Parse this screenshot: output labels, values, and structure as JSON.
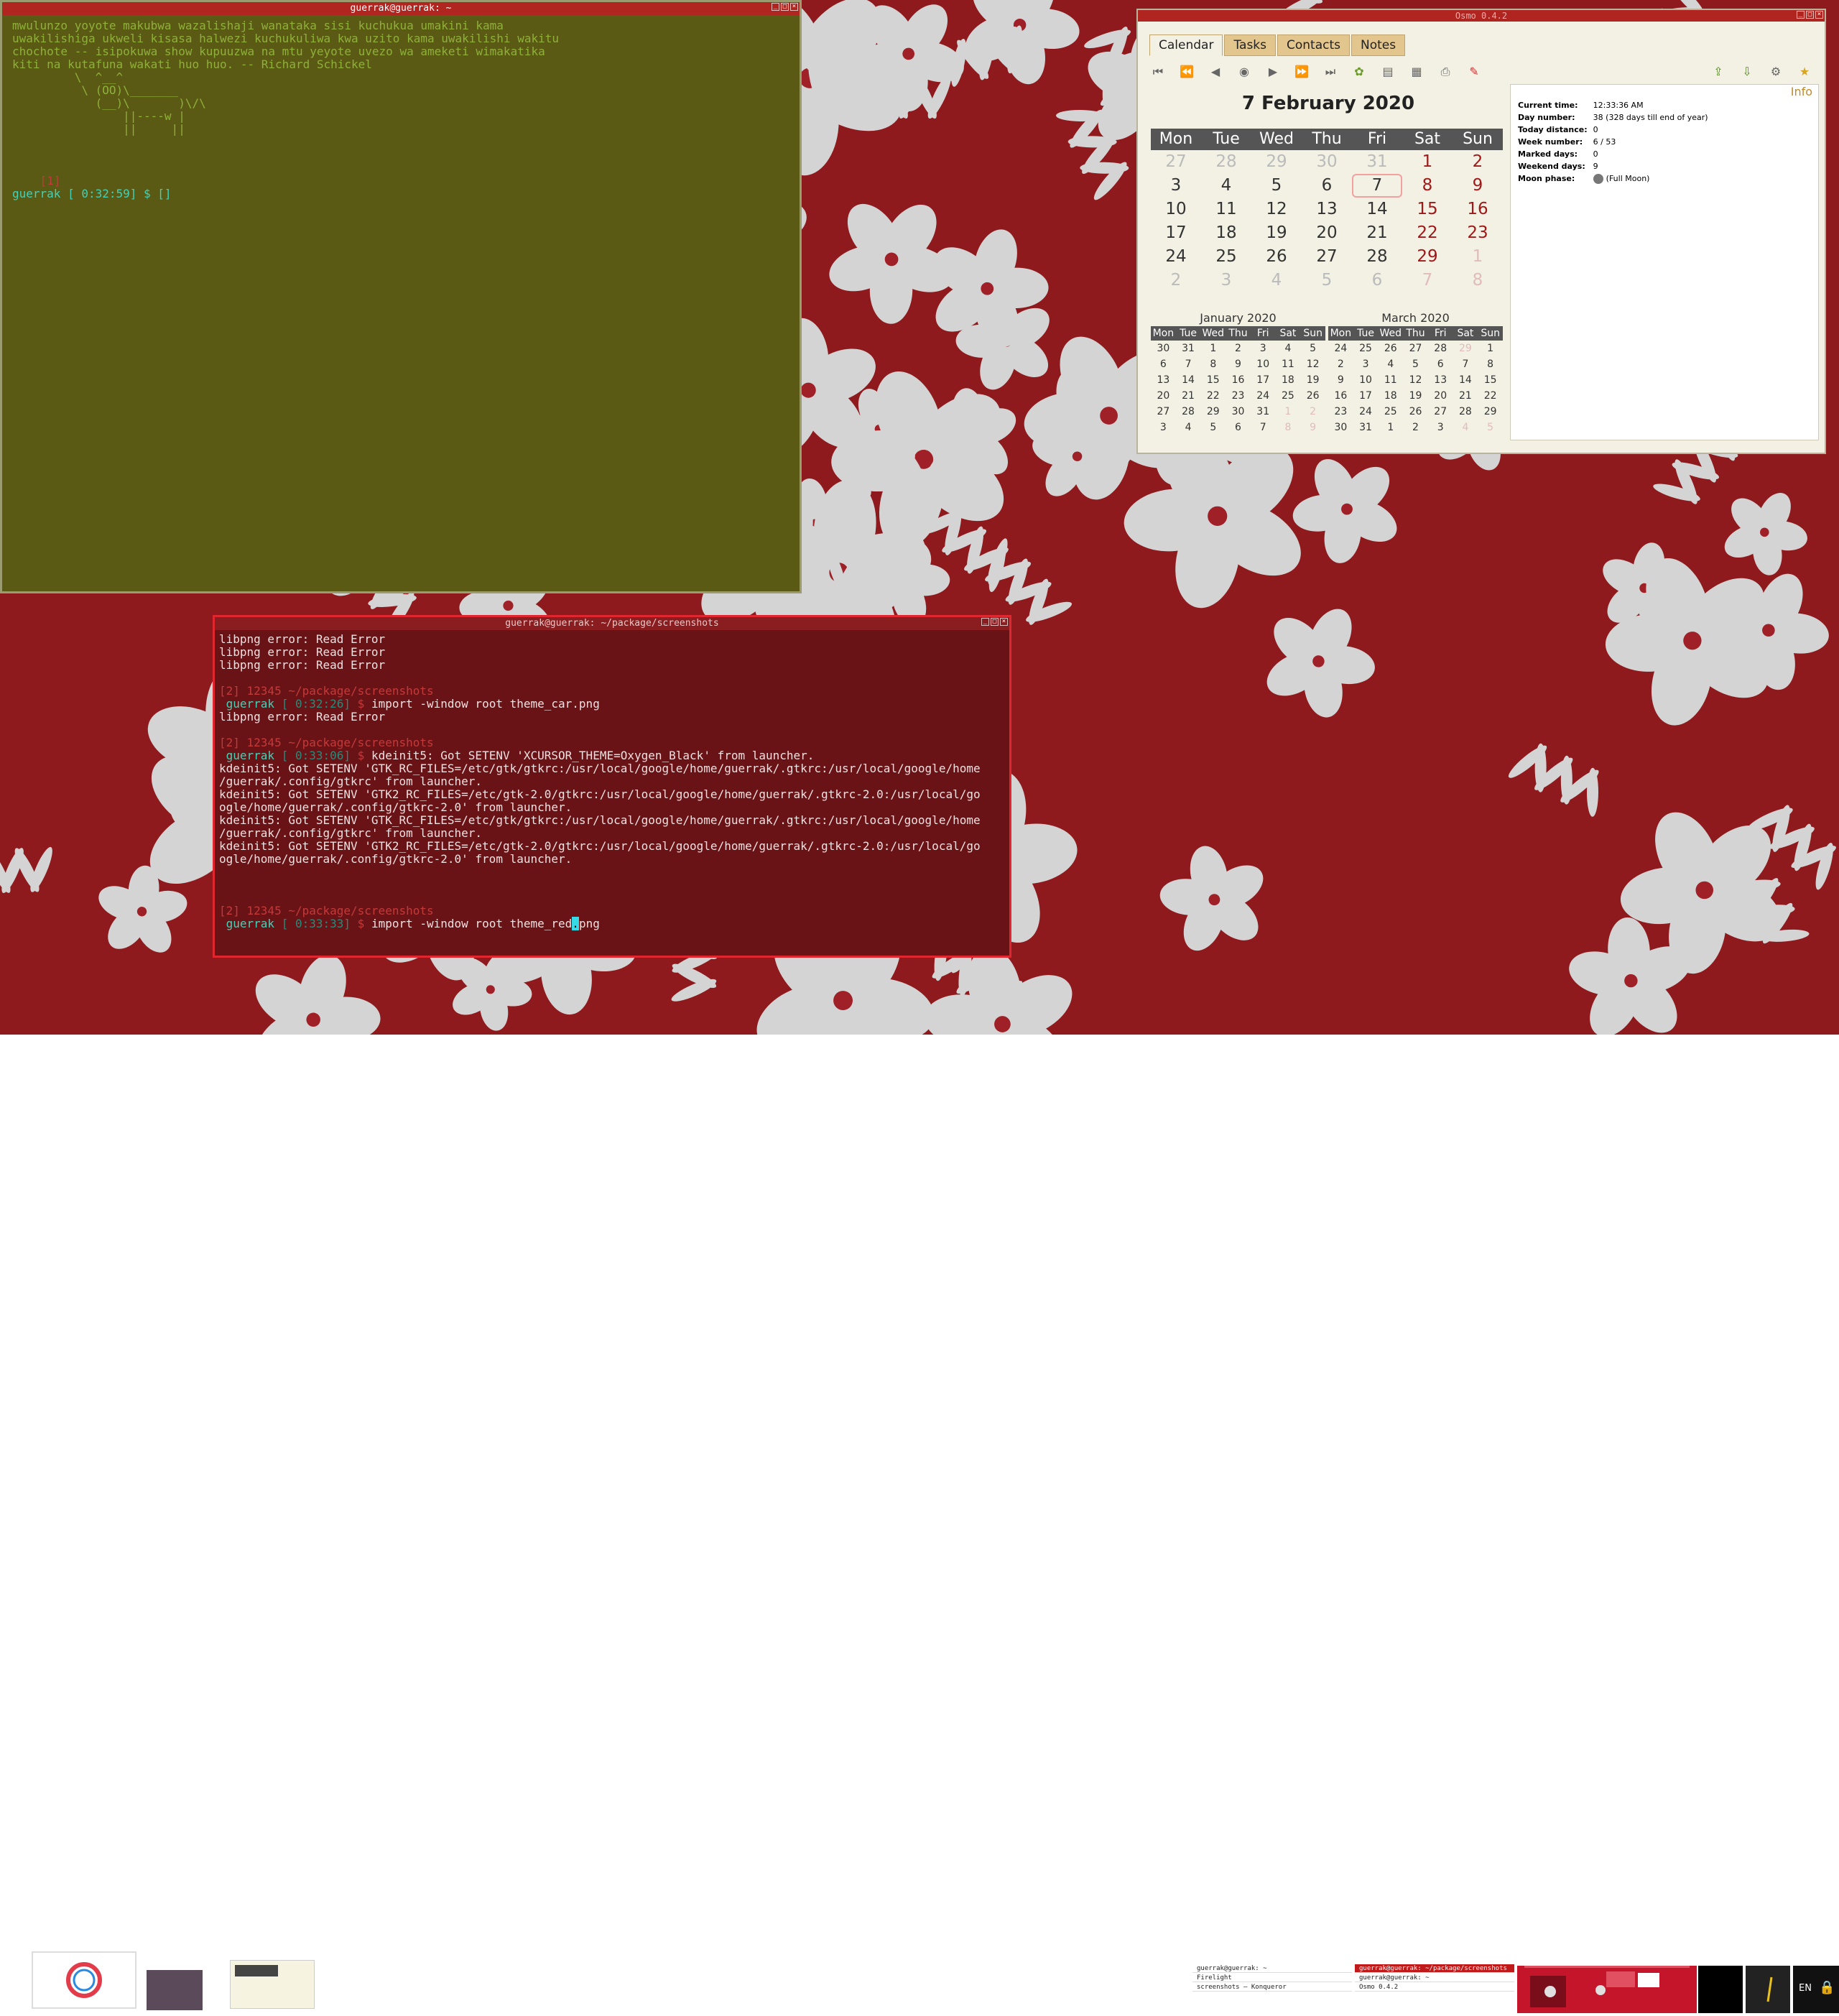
{
  "desktop": {
    "accent": "#b0251f",
    "wallpaper_flower": "#d4d4d4",
    "wallpaper_bg": "#8e1a1e"
  },
  "term1": {
    "title": "guerrak@guerrak: ~",
    "lines": [
      "mwulunzo yoyote makubwa wazalishaji wanataka sisi kuchukua umakini kama",
      "uwakilishiga ukweli kisasa halwezi kuchukuliwa kwa uzito kama uwakilishi wakitu",
      "chochote -- isipokuwa show kupuuzwa na mtu yeyote uvezo wa ameketi wimakatika",
      "kiti na kutafuna wakati huo huo. -- Richard Schickel",
      "         \\  ^__^",
      "          \\ (OO)\\_______",
      "            (__)\\       )\\/\\",
      "                ||----w |",
      "                ||     ||",
      "",
      "",
      "",
      "    [1]",
      "guerrak [ 0:32:59] $ []"
    ]
  },
  "term2": {
    "title": "guerrak@guerrak: ~/package/screenshots",
    "lines": [
      "libpng error: Read Error",
      "libpng error: Read Error",
      "libpng error: Read Error",
      "",
      "[2] 12345 ~/package/screenshots",
      " guerrak [ 0:32:26] $ import -window root theme_car.png",
      "libpng error: Read Error",
      "",
      "[2] 12345 ~/package/screenshots",
      " guerrak [ 0:33:06] $ kdeinit5: Got SETENV 'XCURSOR_THEME=Oxygen_Black' from launcher.",
      "kdeinit5: Got SETENV 'GTK_RC_FILES=/etc/gtk/gtkrc:/usr/local/google/home/guerrak/.gtkrc:/usr/local/google/home",
      "/guerrak/.config/gtkrc' from launcher.",
      "kdeinit5: Got SETENV 'GTK2_RC_FILES=/etc/gtk-2.0/gtkrc:/usr/local/google/home/guerrak/.gtkrc-2.0:/usr/local/go",
      "ogle/home/guerrak/.config/gtkrc-2.0' from launcher.",
      "kdeinit5: Got SETENV 'GTK_RC_FILES=/etc/gtk/gtkrc:/usr/local/google/home/guerrak/.gtkrc:/usr/local/google/home",
      "/guerrak/.config/gtkrc' from launcher.",
      "kdeinit5: Got SETENV 'GTK2_RC_FILES=/etc/gtk-2.0/gtkrc:/usr/local/google/home/guerrak/.gtkrc-2.0:/usr/local/go",
      "ogle/home/guerrak/.config/gtkrc-2.0' from launcher.",
      "",
      "",
      "",
      "[2] 12345 ~/package/screenshots",
      " guerrak [ 0:33:33] $ import -window root theme_red.png"
    ]
  },
  "osmo": {
    "title": "Osmo 0.4.2",
    "tabs": [
      "Calendar",
      "Tasks",
      "Contacts",
      "Notes"
    ],
    "date_title": "7 February 2020",
    "weekdays": [
      "Mon",
      "Tue",
      "Wed",
      "Thu",
      "Fri",
      "Sat",
      "Sun"
    ],
    "main_days": [
      "27",
      "28",
      "29",
      "30",
      "31",
      "1",
      "2",
      "3",
      "4",
      "5",
      "6",
      "7",
      "8",
      "9",
      "10",
      "11",
      "12",
      "13",
      "14",
      "15",
      "16",
      "17",
      "18",
      "19",
      "20",
      "21",
      "22",
      "23",
      "24",
      "25",
      "26",
      "27",
      "28",
      "29",
      "1",
      "2",
      "3",
      "4",
      "5",
      "6",
      "7",
      "8"
    ],
    "jan": {
      "title": "January 2020",
      "days": [
        "30",
        "31",
        "1",
        "2",
        "3",
        "4",
        "5",
        "6",
        "7",
        "8",
        "9",
        "10",
        "11",
        "12",
        "13",
        "14",
        "15",
        "16",
        "17",
        "18",
        "19",
        "20",
        "21",
        "22",
        "23",
        "24",
        "25",
        "26",
        "27",
        "28",
        "29",
        "30",
        "31",
        "1",
        "2",
        "3",
        "4",
        "5",
        "6",
        "7",
        "8",
        "9"
      ]
    },
    "mar": {
      "title": "March 2020",
      "days": [
        "24",
        "25",
        "26",
        "27",
        "28",
        "29",
        "1",
        "2",
        "3",
        "4",
        "5",
        "6",
        "7",
        "8",
        "9",
        "10",
        "11",
        "12",
        "13",
        "14",
        "15",
        "16",
        "17",
        "18",
        "19",
        "20",
        "21",
        "22",
        "23",
        "24",
        "25",
        "26",
        "27",
        "28",
        "29",
        "30",
        "31",
        "1",
        "2",
        "3",
        "4",
        "5"
      ]
    },
    "info": {
      "heading": "Info",
      "rows": [
        {
          "k": "Current time:",
          "v": "12:33:36 AM"
        },
        {
          "k": "Day number:",
          "v": "38 (328 days till end of year)"
        },
        {
          "k": "Today distance:",
          "v": "0"
        },
        {
          "k": "Week number:",
          "v": "6 / 53"
        },
        {
          "k": "Marked days:",
          "v": "0"
        },
        {
          "k": "Weekend days:",
          "v": "9"
        },
        {
          "k": "Moon phase:",
          "v": "(Full Moon)"
        }
      ]
    }
  },
  "taskbar": {
    "tasks": [
      {
        "label": "guerrak@guerrak: ~",
        "active": false
      },
      {
        "label": "guerrak@guerrak: ~/package/screenshots",
        "active": true
      },
      {
        "label": "Firelight",
        "active": false
      },
      {
        "label": "guerrak@guerrak: ~",
        "active": false
      },
      {
        "label": "screenshots — Konqueror",
        "active": false
      },
      {
        "label": "Osmo 0.4.2",
        "active": false
      }
    ],
    "lang": "EN"
  }
}
